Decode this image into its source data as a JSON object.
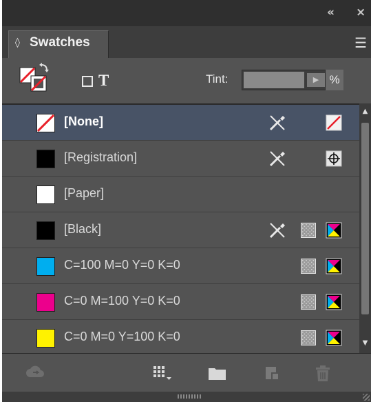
{
  "panel": {
    "title_bar": {
      "collapse_icon": "«",
      "close_icon": "×"
    },
    "tab": {
      "chevron": "◊",
      "label": "Swatches"
    },
    "menu_icon": "☰"
  },
  "toolbar": {
    "t_label": "T",
    "tint_label": "Tint:",
    "tint_value": "",
    "tint_percent_sign": "%",
    "tint_arrow": "▶"
  },
  "swatches": [
    {
      "name": "[None]",
      "chip": "none",
      "selected": true,
      "non_editable": true,
      "mode_icon": "none"
    },
    {
      "name": "[Registration]",
      "chip": "#000000",
      "selected": false,
      "non_editable": true,
      "mode_icon": "registration"
    },
    {
      "name": "[Paper]",
      "chip": "#ffffff",
      "selected": false,
      "non_editable": false,
      "mode_icon": ""
    },
    {
      "name": "[Black]",
      "chip": "#000000",
      "selected": false,
      "non_editable": true,
      "process": true,
      "mode_icon": "cmyk"
    },
    {
      "name": "C=100 M=0 Y=0 K=0",
      "chip": "#00aeef",
      "selected": false,
      "non_editable": false,
      "process": true,
      "mode_icon": "cmyk"
    },
    {
      "name": "C=0 M=100 Y=0 K=0",
      "chip": "#ec008c",
      "selected": false,
      "non_editable": false,
      "process": true,
      "mode_icon": "cmyk"
    },
    {
      "name": "C=0 M=0 Y=100 K=0",
      "chip": "#fff200",
      "selected": false,
      "non_editable": false,
      "process": true,
      "mode_icon": "cmyk"
    }
  ],
  "bottom_bar": {
    "icons": [
      "cloud-sync-icon",
      "swatch-views-icon",
      "new-color-group-icon",
      "new-swatch-icon",
      "delete-swatch-icon"
    ]
  },
  "colors": {
    "panel_bg": "#535353",
    "selected_row": "#485366",
    "accent_red": "#e8202a"
  }
}
